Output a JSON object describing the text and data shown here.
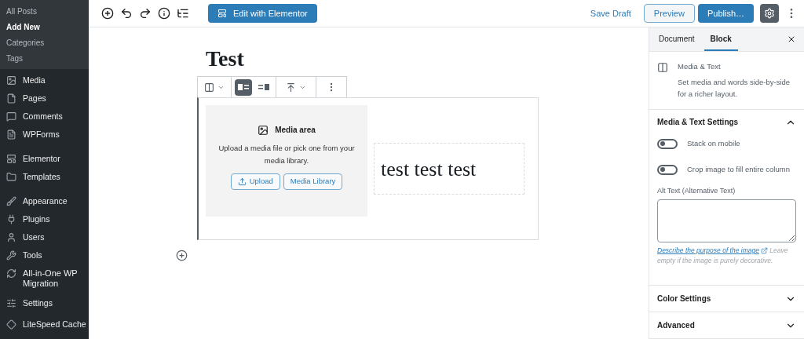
{
  "sidebar": {
    "submenu": [
      {
        "label": "All Posts",
        "selected": false
      },
      {
        "label": "Add New",
        "selected": true
      },
      {
        "label": "Categories",
        "selected": false
      },
      {
        "label": "Tags",
        "selected": false
      }
    ],
    "items": [
      {
        "label": "Media",
        "kind": "media"
      },
      {
        "label": "Pages",
        "kind": "pages"
      },
      {
        "label": "Comments",
        "kind": "comments"
      },
      {
        "label": "WPForms",
        "kind": "forms"
      },
      {
        "label": "Elementor",
        "kind": "elementor"
      },
      {
        "label": "Templates",
        "kind": "folder"
      },
      {
        "label": "Appearance",
        "kind": "brush"
      },
      {
        "label": "Plugins",
        "kind": "plug"
      },
      {
        "label": "Users",
        "kind": "user"
      },
      {
        "label": "Tools",
        "kind": "wrench"
      },
      {
        "label": "All-in-One WP Migration",
        "kind": "migration"
      },
      {
        "label": "Settings",
        "kind": "settings"
      },
      {
        "label": "LiteSpeed Cache",
        "kind": "diamond"
      }
    ]
  },
  "topbar": {
    "elementor_button": "Edit with Elementor",
    "save_draft": "Save Draft",
    "preview": "Preview",
    "publish": "Publish…",
    "settings_selected": true
  },
  "editor": {
    "title": "Test",
    "block_toolbar": [
      {
        "kind": "left",
        "selected": true
      },
      {
        "kind": "right",
        "selected": false
      }
    ],
    "media_area": {
      "title": "Media area",
      "description": "Upload a media file or pick one from your media library.",
      "buttons": [
        {
          "label": "Upload",
          "kind": "upload"
        },
        {
          "label": "Media Library",
          "kind": "plain"
        }
      ]
    },
    "text": "test test test"
  },
  "panel": {
    "tabs": [
      {
        "label": "Document",
        "selected": false
      },
      {
        "label": "Block",
        "selected": true
      }
    ],
    "block": {
      "name": "Media & Text",
      "description": "Set media and words side-by-side for a richer layout."
    },
    "sections": [
      {
        "title": "Media & Text Settings",
        "expanded": true
      },
      {
        "title": "Color Settings",
        "expanded": false
      },
      {
        "title": "Advanced",
        "expanded": false
      }
    ],
    "toggles": [
      {
        "label": "Stack on mobile",
        "on": false
      },
      {
        "label": "Crop image to fill entire column",
        "on": false
      }
    ],
    "alt_label": "Alt Text (Alternative Text)",
    "help_link": "Describe the purpose of the image",
    "help_text": "Leave empty if the image is purely decorative."
  }
}
